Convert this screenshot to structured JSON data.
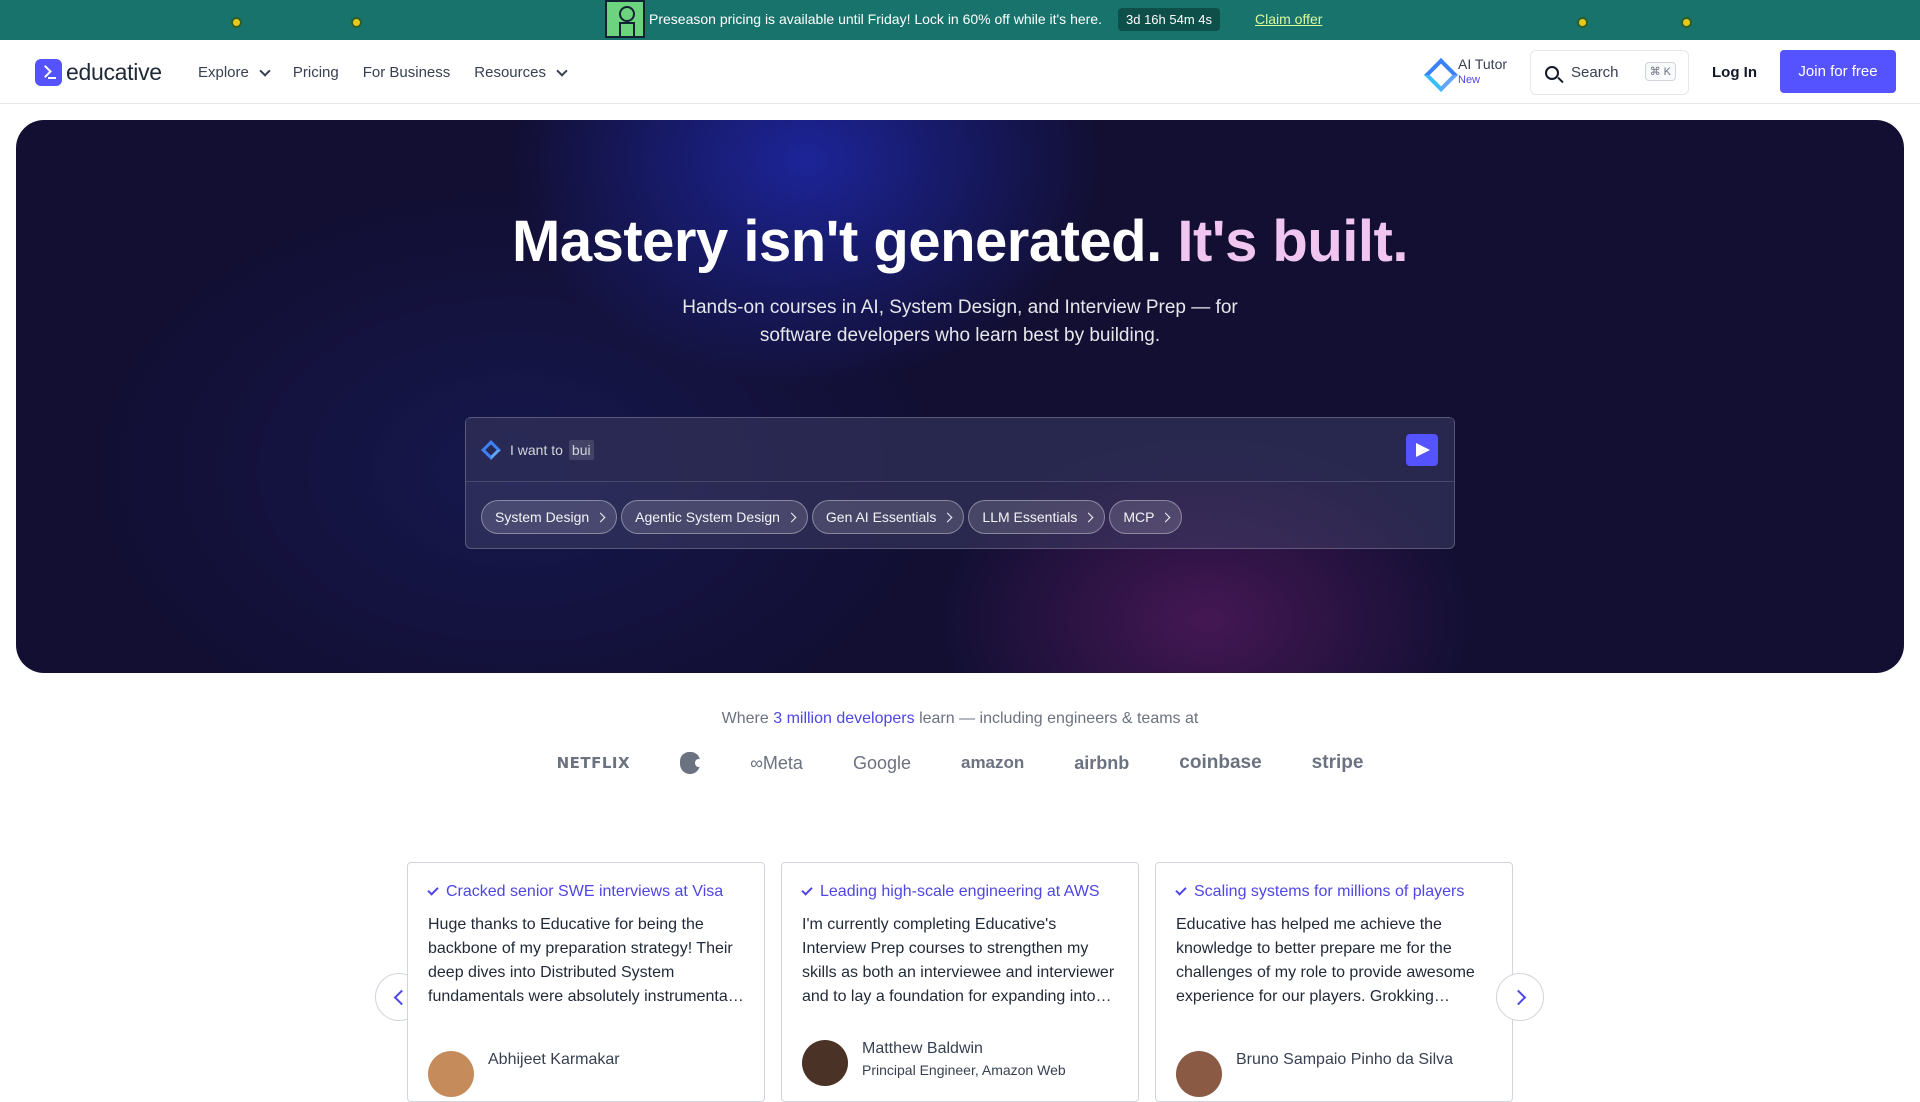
{
  "promo": {
    "text": "Preseason pricing is available until Friday! Lock in 60% off while it's here.",
    "timer": "3d 16h 54m 4s",
    "cta": "Claim offer",
    "background": "#17736c"
  },
  "header": {
    "logo": "educative",
    "nav": [
      {
        "label": "Explore",
        "has_menu": true
      },
      {
        "label": "Pricing",
        "has_menu": false
      },
      {
        "label": "For Business",
        "has_menu": false
      },
      {
        "label": "Resources",
        "has_menu": true
      }
    ],
    "ai_tutor": {
      "label": "AI Tutor",
      "badge": "New"
    },
    "search": {
      "label": "Search",
      "shortcut": "⌘ K"
    },
    "login": "Log In",
    "join": "Join for free",
    "accent": "#5553ff"
  },
  "hero": {
    "title_main": "Mastery isn't generated.",
    "title_accent": "It's built.",
    "subtitle": "Hands-on courses in AI, System Design, and Interview Prep — for software developers who learn best by building.",
    "prompt": {
      "prefix": "I want to",
      "typed": "bui",
      "chips": [
        "System Design",
        "Agentic System Design",
        "Gen AI Essentials",
        "LLM Essentials",
        "MCP"
      ]
    }
  },
  "trust": {
    "before": "Where",
    "highlight": "3 million developers",
    "after": "learn — including engineers & teams at",
    "brands": [
      "NETFLIX",
      "Apple",
      "Meta",
      "Google",
      "amazon",
      "airbnb",
      "coinbase",
      "stripe"
    ]
  },
  "testimonials": [
    {
      "headline": "Cracked senior SWE interviews at Visa",
      "body": "Huge thanks to Educative for being the backbone of my preparation strategy! Their deep dives into Distributed System fundamentals were absolutely instrumenta…",
      "name": "Abhijeet Karmakar",
      "role": ""
    },
    {
      "headline": "Leading high-scale engineering at AWS",
      "body": "I'm currently completing Educative's Interview Prep courses to strengthen my skills as both an interviewee and interviewer and to lay a foundation for expanding into…",
      "name": "Matthew Baldwin",
      "role": "Principal Engineer, Amazon Web"
    },
    {
      "headline": "Scaling systems for millions of players",
      "body": "Educative has helped me achieve the knowledge to better prepare me for the challenges of my role to provide awesome experience for our players. Grokking…",
      "name": "Bruno Sampaio Pinho da Silva",
      "role": ""
    }
  ]
}
